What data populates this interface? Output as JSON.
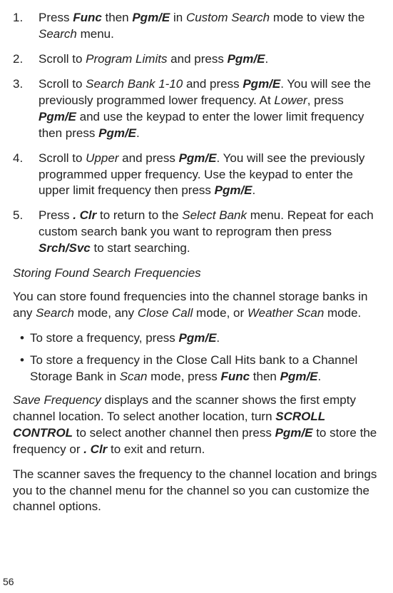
{
  "steps": [
    {
      "num": "1.",
      "parts": [
        {
          "t": "Press ",
          "c": ""
        },
        {
          "t": "Func",
          "c": "bi"
        },
        {
          "t": " then ",
          "c": ""
        },
        {
          "t": "Pgm/E",
          "c": "bi"
        },
        {
          "t": " in ",
          "c": ""
        },
        {
          "t": "Custom Search",
          "c": "i"
        },
        {
          "t": " mode to view the ",
          "c": ""
        },
        {
          "t": "Search",
          "c": "i"
        },
        {
          "t": " menu.",
          "c": ""
        }
      ]
    },
    {
      "num": "2.",
      "parts": [
        {
          "t": "Scroll to ",
          "c": ""
        },
        {
          "t": "Program Limits",
          "c": "i"
        },
        {
          "t": " and press ",
          "c": ""
        },
        {
          "t": "Pgm/E",
          "c": "bi"
        },
        {
          "t": ".",
          "c": ""
        }
      ]
    },
    {
      "num": "3.",
      "parts": [
        {
          "t": "Scroll to ",
          "c": ""
        },
        {
          "t": "Search Bank 1-10",
          "c": "i"
        },
        {
          "t": " and press ",
          "c": ""
        },
        {
          "t": "Pgm/E",
          "c": "bi"
        },
        {
          "t": ". You will see the previously programmed lower frequency. At ",
          "c": ""
        },
        {
          "t": "Lower",
          "c": "i"
        },
        {
          "t": ", press ",
          "c": ""
        },
        {
          "t": "Pgm/E",
          "c": "bi"
        },
        {
          "t": " and use the keypad to enter the lower limit frequency then press ",
          "c": ""
        },
        {
          "t": "Pgm/E",
          "c": "bi"
        },
        {
          "t": ".",
          "c": ""
        }
      ]
    },
    {
      "num": "4.",
      "parts": [
        {
          "t": "Scroll to ",
          "c": ""
        },
        {
          "t": "Upper",
          "c": "i"
        },
        {
          "t": " and press ",
          "c": ""
        },
        {
          "t": "Pgm/E",
          "c": "bi"
        },
        {
          "t": ". You will see the previously programmed upper frequency. Use the keypad to enter the upper limit frequency then press ",
          "c": ""
        },
        {
          "t": "Pgm/E",
          "c": "bi"
        },
        {
          "t": ".",
          "c": ""
        }
      ]
    },
    {
      "num": "5.",
      "parts": [
        {
          "t": "Press ",
          "c": ""
        },
        {
          "t": ". Clr",
          "c": "bi"
        },
        {
          "t": " to return to the ",
          "c": ""
        },
        {
          "t": "Select Bank",
          "c": "i"
        },
        {
          "t": " menu. Repeat for each custom search bank you want to reprogram then press ",
          "c": ""
        },
        {
          "t": "Srch/Svc",
          "c": "bi"
        },
        {
          "t": " to start searching.",
          "c": ""
        }
      ]
    }
  ],
  "subheading": "Storing Found Search Frequencies",
  "para1": [
    {
      "t": "You can store found frequencies into the channel storage banks in any ",
      "c": ""
    },
    {
      "t": "Search",
      "c": "i"
    },
    {
      "t": " mode, any ",
      "c": ""
    },
    {
      "t": "Close Call",
      "c": "i"
    },
    {
      "t": " mode, or ",
      "c": ""
    },
    {
      "t": "Weather Scan",
      "c": "i"
    },
    {
      "t": " mode.",
      "c": ""
    }
  ],
  "bullets": [
    {
      "parts": [
        {
          "t": "To store a frequency, press ",
          "c": ""
        },
        {
          "t": "Pgm/E",
          "c": "bi"
        },
        {
          "t": ".",
          "c": ""
        }
      ]
    },
    {
      "parts": [
        {
          "t": "To store a frequency in the Close Call Hits bank to a Channel Storage Bank in ",
          "c": ""
        },
        {
          "t": "Scan",
          "c": "i"
        },
        {
          "t": " mode, press ",
          "c": ""
        },
        {
          "t": "Func",
          "c": "bi"
        },
        {
          "t": " then ",
          "c": ""
        },
        {
          "t": "Pgm/E",
          "c": "bi"
        },
        {
          "t": ".",
          "c": ""
        }
      ]
    }
  ],
  "para2": [
    {
      "t": "Save Frequency",
      "c": "i"
    },
    {
      "t": " displays and the scanner shows the first empty channel location. To select another location, turn ",
      "c": ""
    },
    {
      "t": "SCROLL CONTROL",
      "c": "bi"
    },
    {
      "t": " to select another channel then press ",
      "c": ""
    },
    {
      "t": "Pgm/E",
      "c": "bi"
    },
    {
      "t": " to store the frequency or ",
      "c": ""
    },
    {
      "t": ". Clr",
      "c": "bi"
    },
    {
      "t": " to exit and return.",
      "c": ""
    }
  ],
  "para3": [
    {
      "t": "The scanner saves the frequency to the channel location and brings you to the channel menu for the channel so you can customize the channel options.",
      "c": ""
    }
  ],
  "page_number": "56",
  "bullet_char": "•"
}
